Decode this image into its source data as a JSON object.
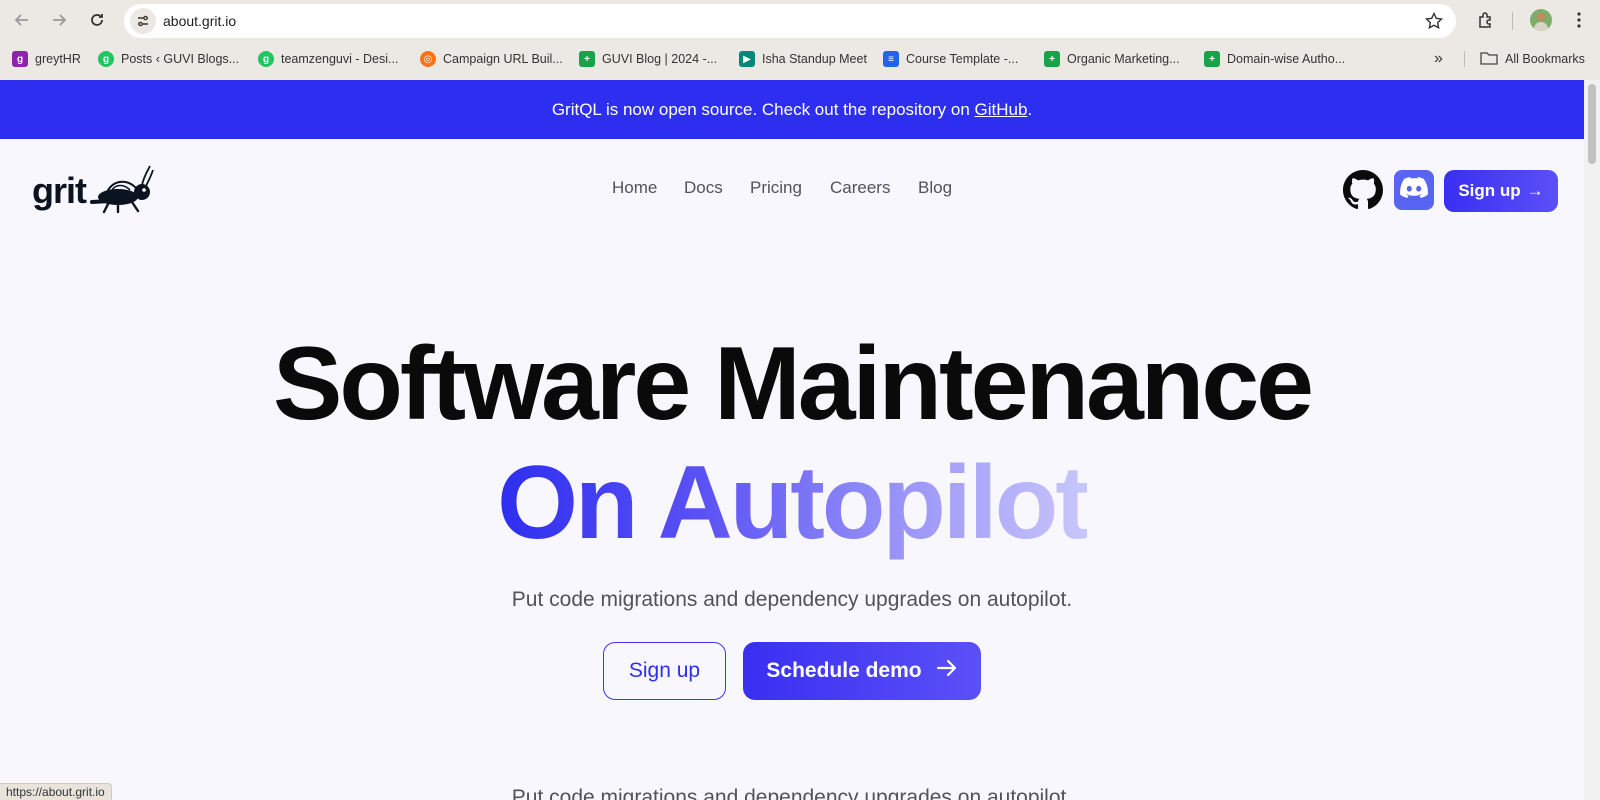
{
  "browser": {
    "url": "about.grit.io",
    "status_url": "https://about.grit.io",
    "bookmarks": [
      {
        "label": "greytHR",
        "icon": "greythr-icon",
        "color": "#8e24aa",
        "glyph": "g"
      },
      {
        "label": "Posts ‹ GUVI Blogs...",
        "icon": "guvi-icon",
        "color": "#22c55e",
        "glyph": "g"
      },
      {
        "label": "teamzenguvi - Desi...",
        "icon": "guvi-icon",
        "color": "#22c55e",
        "glyph": "g"
      },
      {
        "label": "Campaign URL Buil...",
        "icon": "campaign-icon",
        "color": "#f97316",
        "glyph": "◎"
      },
      {
        "label": "GUVI Blog | 2024 -...",
        "icon": "sheets-icon",
        "color": "#16a34a",
        "glyph": "+"
      },
      {
        "label": "Isha Standup Meet",
        "icon": "meet-icon",
        "color": "#00897b",
        "glyph": "▶"
      },
      {
        "label": "Course Template -...",
        "icon": "docs-icon",
        "color": "#2563eb",
        "glyph": "≡"
      },
      {
        "label": "Organic Marketing...",
        "icon": "sheets-icon",
        "color": "#16a34a",
        "glyph": "+"
      },
      {
        "label": "Domain-wise Autho...",
        "icon": "sheets-icon",
        "color": "#16a34a",
        "glyph": "+"
      }
    ],
    "bookmarks_overflow": "»",
    "all_bookmarks": "All Bookmarks"
  },
  "banner": {
    "text_before": "GritQL is now open source. Check out the repository on ",
    "link": "GitHub",
    "text_after": "."
  },
  "nav": {
    "logo": "grit",
    "links": [
      "Home",
      "Docs",
      "Pricing",
      "Careers",
      "Blog"
    ],
    "signup": "Sign up",
    "signup_arrow": "→"
  },
  "hero": {
    "title": "Software Maintenance",
    "subtitle": "On Autopilot",
    "description": "Put code migrations and dependency upgrades on autopilot.",
    "signup": "Sign up",
    "demo": "Schedule demo",
    "demo_arrow": "→",
    "peek": "Put code migrations and dependency upgrades on autopilot."
  },
  "colors": {
    "brand": "#2d2ef0",
    "gradient_end": "#c9c6fb",
    "discord": "#5865f2"
  }
}
